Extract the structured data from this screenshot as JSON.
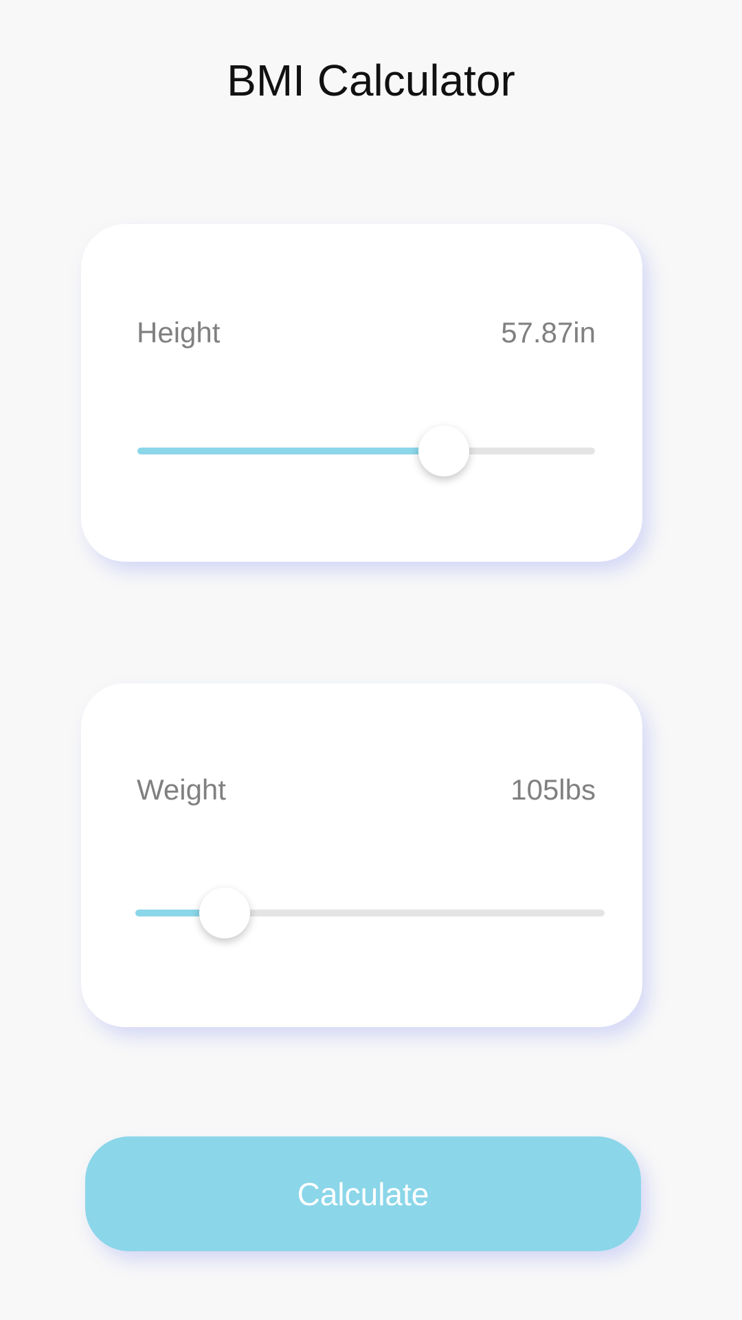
{
  "app": {
    "title": "BMI Calculator"
  },
  "height_card": {
    "label": "Height",
    "value_text": "57.87in",
    "slider_fraction": 0.67
  },
  "weight_card": {
    "label": "Weight",
    "value_text": "105lbs",
    "slider_fraction": 0.19
  },
  "actions": {
    "calculate_label": "Calculate"
  },
  "colors": {
    "background": "#f8f8f8",
    "card": "#ffffff",
    "accent": "#8bd6e9",
    "track": "#e4e4e4",
    "label_text": "#808080",
    "title_text": "#111111",
    "button_text": "#ffffff"
  }
}
